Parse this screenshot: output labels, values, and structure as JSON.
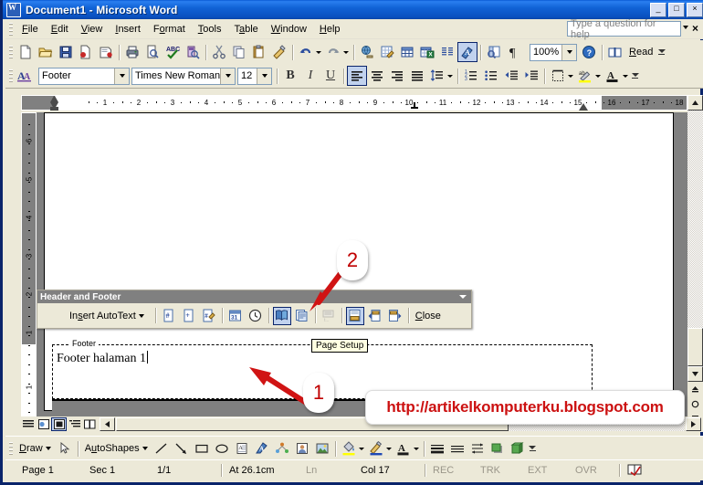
{
  "window": {
    "title": "Document1 - Microsoft Word",
    "icon": "word-document-icon",
    "buttons": {
      "minimize": "_",
      "maximize": "□",
      "close": "×"
    }
  },
  "menubar": {
    "items": [
      {
        "label": "File",
        "accel": "F"
      },
      {
        "label": "Edit",
        "accel": "E"
      },
      {
        "label": "View",
        "accel": "V"
      },
      {
        "label": "Insert",
        "accel": "I"
      },
      {
        "label": "Format",
        "accel": "o"
      },
      {
        "label": "Tools",
        "accel": "T"
      },
      {
        "label": "Table",
        "accel": "a"
      },
      {
        "label": "Window",
        "accel": "W"
      },
      {
        "label": "Help",
        "accel": "H"
      }
    ],
    "help_box": {
      "placeholder": "Type a question for help",
      "value": ""
    },
    "close_label": "×"
  },
  "standard_toolbar": {
    "name": "Standard",
    "buttons": [
      {
        "name": "new-blank-document-icon",
        "tip": "New Blank Document"
      },
      {
        "name": "open-icon",
        "tip": "Open"
      },
      {
        "name": "save-icon",
        "tip": "Save"
      },
      {
        "name": "mail-recipient-icon",
        "tip": "E-mail"
      },
      {
        "name": "print-preview-search-icon",
        "tip": "Search"
      },
      {
        "name": "print-icon",
        "tip": "Print"
      },
      {
        "name": "print-preview-icon",
        "tip": "Print Preview"
      },
      {
        "name": "spelling-grammar-icon",
        "tip": "Spelling and Grammar"
      },
      {
        "name": "research-icon",
        "tip": "Research"
      },
      {
        "name": "cut-icon",
        "tip": "Cut"
      },
      {
        "name": "copy-icon",
        "tip": "Copy"
      },
      {
        "name": "paste-icon",
        "tip": "Paste"
      },
      {
        "name": "format-painter-icon",
        "tip": "Format Painter"
      },
      {
        "name": "undo-icon",
        "tip": "Undo"
      },
      {
        "name": "redo-icon",
        "tip": "Redo"
      },
      {
        "name": "insert-hyperlink-icon",
        "tip": "Insert Hyperlink"
      },
      {
        "name": "tables-and-borders-icon",
        "tip": "Tables and Borders"
      },
      {
        "name": "insert-table-icon",
        "tip": "Insert Table"
      },
      {
        "name": "insert-excel-worksheet-icon",
        "tip": "Insert Microsoft Excel Worksheet"
      },
      {
        "name": "columns-icon",
        "tip": "Columns"
      },
      {
        "name": "drawing-icon",
        "tip": "Drawing"
      },
      {
        "name": "document-map-icon",
        "tip": "Document Map"
      },
      {
        "name": "show-hide-paragraph-icon",
        "tip": "Show/Hide"
      }
    ],
    "zoom": {
      "value": "100%",
      "name": "zoom-combo"
    },
    "help_icon": "help-icon",
    "read_label": "Read",
    "read_accel": "R"
  },
  "formatting_toolbar": {
    "name": "Formatting",
    "styles_icon": "styles-and-formatting-icon",
    "style": {
      "value": "Footer",
      "name": "style-combo"
    },
    "font": {
      "value": "Times New Roman",
      "name": "font-combo"
    },
    "size": {
      "value": "12",
      "name": "font-size-combo"
    },
    "bold": "B",
    "italic": "I",
    "underline": "U",
    "align_left": "align-left-icon",
    "align_center": "align-center-icon",
    "align_right": "align-right-icon",
    "align_justify": "align-justify-icon",
    "line_spacing": "line-spacing-icon",
    "numbering": "numbering-icon",
    "bullets": "bullets-icon",
    "decrease_indent": "decrease-indent-icon",
    "increase_indent": "increase-indent-icon",
    "borders": "outside-border-icon",
    "highlight": "highlight-icon",
    "font_color": "font-color-icon"
  },
  "ruler": {
    "name": "horizontal-ruler",
    "numbers": [
      1,
      2,
      3,
      4,
      5,
      6,
      7,
      8,
      9,
      10,
      11,
      12,
      13,
      14,
      15,
      16,
      17,
      18
    ],
    "vertical_numbers": [
      6,
      5,
      4,
      3,
      2,
      1,
      1
    ],
    "unit": "cm"
  },
  "document": {
    "footer_label": "Footer",
    "footer_text": "Footer halaman 1",
    "tooltip": "Page Setup"
  },
  "header_footer_toolbar": {
    "title": "Header and Footer",
    "insert_autotext": "Insert AutoText",
    "insert_autotext_accel": "s",
    "buttons": [
      {
        "name": "insert-page-number-icon",
        "tip": "Insert Page Number",
        "state": "normal"
      },
      {
        "name": "insert-number-of-pages-icon",
        "tip": "Insert Number of Pages",
        "state": "normal"
      },
      {
        "name": "format-page-number-icon",
        "tip": "Format Page Number",
        "state": "normal"
      },
      {
        "name": "insert-date-icon",
        "tip": "Insert Date",
        "state": "normal"
      },
      {
        "name": "insert-time-icon",
        "tip": "Insert Time",
        "state": "normal"
      },
      {
        "name": "page-setup-icon",
        "tip": "Page Setup",
        "state": "pressed"
      },
      {
        "name": "show-hide-document-text-icon",
        "tip": "Show/Hide Document Text",
        "state": "normal"
      },
      {
        "name": "same-as-previous-icon",
        "tip": "Link to Previous",
        "state": "disabled"
      },
      {
        "name": "switch-header-footer-icon",
        "tip": "Switch Between Header and Footer",
        "state": "pressed"
      },
      {
        "name": "show-previous-icon",
        "tip": "Show Previous",
        "state": "normal"
      },
      {
        "name": "show-next-icon",
        "tip": "Show Next",
        "state": "normal"
      }
    ],
    "close_label": "Close",
    "close_accel": "C"
  },
  "annotations": [
    {
      "number": "2",
      "name": "annotation-badge-2",
      "color": "#c00000"
    },
    {
      "number": "1",
      "name": "annotation-badge-1",
      "color": "#c00000"
    }
  ],
  "watermark": {
    "text": "http://artikelkomputerku.blogspot.com",
    "color": "#cc1111"
  },
  "drawing_toolbar": {
    "draw_label": "Draw",
    "draw_accel": "D",
    "select_objects": "select-objects-icon",
    "autoshapes_label": "AutoShapes",
    "autoshapes_accel": "u",
    "buttons": [
      {
        "name": "line-icon"
      },
      {
        "name": "arrow-icon"
      },
      {
        "name": "rectangle-icon"
      },
      {
        "name": "oval-icon"
      },
      {
        "name": "text-box-icon"
      },
      {
        "name": "wordart-icon"
      },
      {
        "name": "diagram-icon"
      },
      {
        "name": "clip-art-icon"
      },
      {
        "name": "picture-icon"
      },
      {
        "name": "fill-color-icon"
      },
      {
        "name": "line-color-icon"
      },
      {
        "name": "font-color-icon"
      },
      {
        "name": "line-style-icon"
      },
      {
        "name": "dash-style-icon"
      },
      {
        "name": "arrow-style-icon"
      },
      {
        "name": "shadow-style-icon"
      },
      {
        "name": "3d-style-icon"
      }
    ]
  },
  "statusbar": {
    "page": "Page 1",
    "section": "Sec 1",
    "pages": "1/1",
    "at": "At 26.1cm",
    "line": "Ln",
    "col": "Col 17",
    "rec": "REC",
    "trk": "TRK",
    "ext": "EXT",
    "ovr": "OVR",
    "language_icon": "spelling-status-icon"
  },
  "view_buttons": [
    {
      "name": "normal-view-button"
    },
    {
      "name": "web-layout-view-button"
    },
    {
      "name": "print-layout-view-button"
    },
    {
      "name": "outline-view-button"
    },
    {
      "name": "reading-layout-view-button"
    }
  ]
}
